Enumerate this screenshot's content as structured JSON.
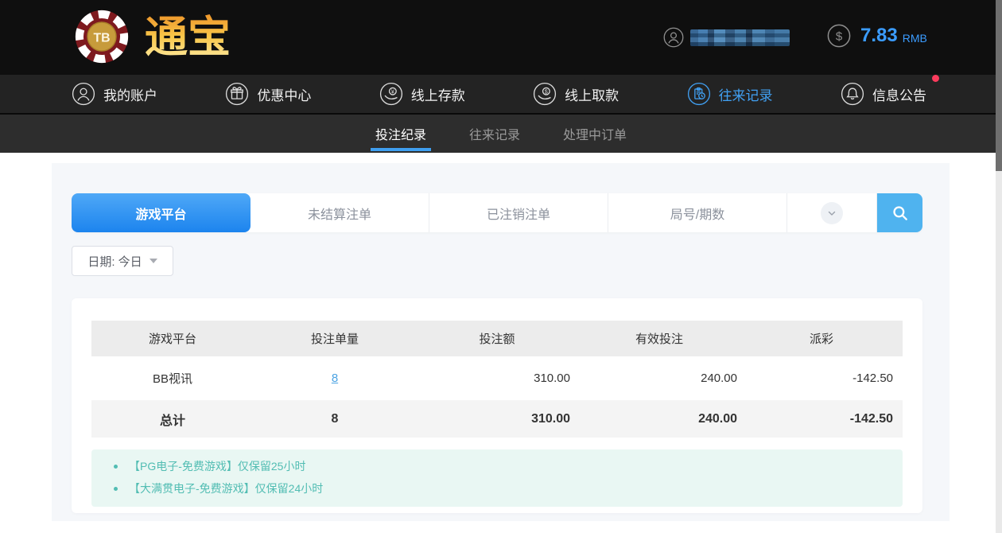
{
  "brand": {
    "chip_text": "TB",
    "name": "通宝"
  },
  "topbar": {
    "balance": "7.83",
    "currency": "RMB"
  },
  "nav": {
    "items": [
      {
        "label": "我的账户"
      },
      {
        "label": "优惠中心"
      },
      {
        "label": "线上存款"
      },
      {
        "label": "线上取款"
      },
      {
        "label": "往来记录"
      },
      {
        "label": "信息公告"
      }
    ]
  },
  "subnav": {
    "items": [
      {
        "label": "投注纪录"
      },
      {
        "label": "往来记录"
      },
      {
        "label": "处理中订单"
      }
    ]
  },
  "toolbar": {
    "tabs": [
      {
        "label": "游戏平台"
      },
      {
        "label": "未结算注单"
      },
      {
        "label": "已注销注单"
      },
      {
        "label": "局号/期数"
      }
    ],
    "date_filter": "日期: 今日"
  },
  "table": {
    "headers": [
      "游戏平台",
      "投注单量",
      "投注额",
      "有效投注",
      "派彩"
    ],
    "rows": [
      {
        "platform": "BB视讯",
        "bet_count": "8",
        "bet_amount": "310.00",
        "valid_bet": "240.00",
        "payout": "-142.50"
      }
    ],
    "total": {
      "label": "总计",
      "bet_count": "8",
      "bet_amount": "310.00",
      "valid_bet": "240.00",
      "payout": "-142.50"
    }
  },
  "notes": {
    "items": [
      "【PG电子-免费游戏】仅保留25小时",
      "【大满贯电子-免费游戏】仅保留24小时"
    ]
  },
  "colors": {
    "accent_blue": "#3f9ff0",
    "active_tab_top": "#4fa8f7",
    "active_tab_bottom": "#1c84ee",
    "search_button": "#4fb3ef",
    "negative": "#f2556e",
    "note_teal": "#52bdb3",
    "badge_red": "#fb3b5c",
    "gold": "#f0b43c"
  }
}
